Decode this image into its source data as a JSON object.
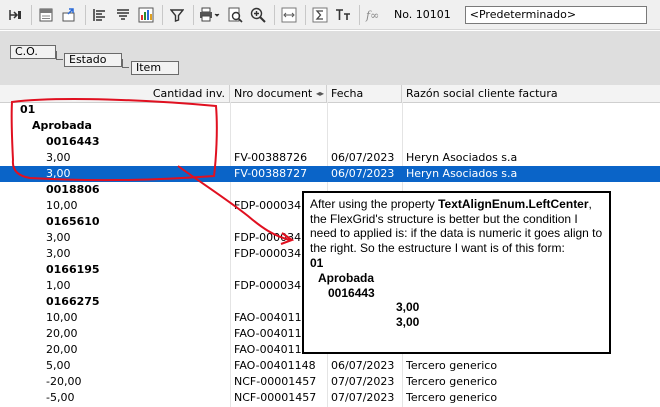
{
  "toolbar": {
    "icons": [
      "expand-all-icon",
      "export-excel-icon",
      "export-icon",
      "align-left-icon",
      "align-justify-icon",
      "chart-icon",
      "filter-icon",
      "print-icon",
      "print-preview-icon",
      "zoom-icon",
      "fit-column-icon",
      "sum-icon",
      "text-size-icon",
      "function-icon"
    ],
    "number_label": "No. 10101",
    "layout_combo_value": "<Predeterminado>"
  },
  "group_by": {
    "chips": [
      "C.O.",
      "Estado",
      "Item"
    ]
  },
  "grid": {
    "columns": [
      "Cantidad inv.",
      "Nro document",
      "Fecha",
      "Razón social cliente factura"
    ],
    "rows": [
      {
        "type": "group",
        "level": 0,
        "label": "01"
      },
      {
        "type": "group",
        "level": 1,
        "label": "Aprobada"
      },
      {
        "type": "group",
        "level": 2,
        "label": "0016443"
      },
      {
        "type": "data",
        "qty": "3,00",
        "doc": "FV-00388726",
        "date": "06/07/2023",
        "razon": "Heryn Asociados  s.a"
      },
      {
        "type": "data",
        "qty": "3,00",
        "doc": "FV-00388727",
        "date": "06/07/2023",
        "razon": "Heryn Asociados  s.a",
        "selected": true
      },
      {
        "type": "group",
        "level": 2,
        "label": "0018806"
      },
      {
        "type": "data",
        "qty": "10,00",
        "doc": "FDP-0000341",
        "date": "",
        "razon": ""
      },
      {
        "type": "group",
        "level": 2,
        "label": "0165610"
      },
      {
        "type": "data",
        "qty": "3,00",
        "doc": "FDP-0000341",
        "date": "",
        "razon": ""
      },
      {
        "type": "data",
        "qty": "3,00",
        "doc": "FDP-0000341",
        "date": "",
        "razon": ""
      },
      {
        "type": "group",
        "level": 2,
        "label": "0166195"
      },
      {
        "type": "data",
        "qty": "1,00",
        "doc": "FDP-0000341",
        "date": "",
        "razon": ""
      },
      {
        "type": "group",
        "level": 2,
        "label": "0166275"
      },
      {
        "type": "data",
        "qty": "10,00",
        "doc": "FAO-0040114",
        "date": "",
        "razon": ""
      },
      {
        "type": "data",
        "qty": "20,00",
        "doc": "FAO-0040114",
        "date": "",
        "razon": ""
      },
      {
        "type": "data",
        "qty": "20,00",
        "doc": "FAO-0040114",
        "date": "",
        "razon": ""
      },
      {
        "type": "data",
        "qty": "5,00",
        "doc": "FAO-00401148",
        "date": "06/07/2023",
        "razon": "Tercero generico"
      },
      {
        "type": "data",
        "qty": "-20,00",
        "doc": "NCF-00001457",
        "date": "07/07/2023",
        "razon": "Tercero generico"
      },
      {
        "type": "data",
        "qty": "-5,00",
        "doc": "NCF-00001457",
        "date": "07/07/2023",
        "razon": "Tercero generico"
      }
    ]
  },
  "callout": {
    "intro_before": "After using the property ",
    "property": "TextAlignEnum.LeftCenter",
    "intro_after": ", the FlexGrid's structure is better but the condition I need to applied is: if the data is numeric it goes align to the right. So the estructure I want is of this form:",
    "example": [
      "01",
      "Aprobada",
      "0016443",
      "3,00",
      "3,00"
    ]
  },
  "colors": {
    "selection": "#0a64c8",
    "annotation": "#e01020"
  }
}
